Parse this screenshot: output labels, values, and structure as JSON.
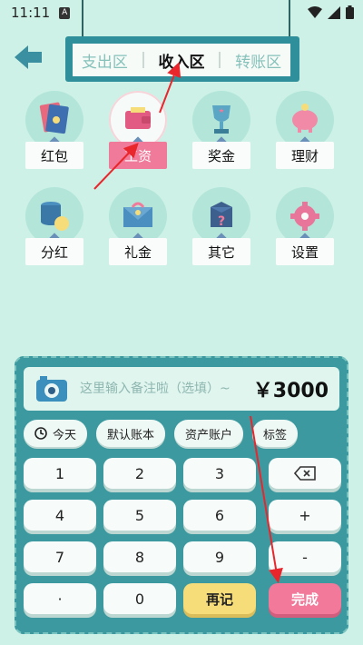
{
  "status": {
    "time": "11:11",
    "notif": "A"
  },
  "header": {
    "tabs": [
      {
        "label": "支出区",
        "active": false
      },
      {
        "label": "收入区",
        "active": true
      },
      {
        "label": "转账区",
        "active": false
      }
    ]
  },
  "categories": [
    {
      "label": "红包",
      "icon": "red-envelope-icon"
    },
    {
      "label": "工资",
      "icon": "wallet-icon",
      "selected": true
    },
    {
      "label": "奖金",
      "icon": "trophy-icon"
    },
    {
      "label": "理财",
      "icon": "piggy-bank-icon"
    },
    {
      "label": "分红",
      "icon": "coins-icon"
    },
    {
      "label": "礼金",
      "icon": "gift-envelope-icon"
    },
    {
      "label": "其它",
      "icon": "question-box-icon"
    },
    {
      "label": "设置",
      "icon": "gear-icon"
    }
  ],
  "entry": {
    "note_placeholder": "这里输入备注啦（选填）~",
    "amount": "￥3000"
  },
  "chips": [
    "今天",
    "默认账本",
    "资产账户",
    "标签"
  ],
  "keypad": {
    "rows": [
      [
        "1",
        "2",
        "3",
        "⌫"
      ],
      [
        "4",
        "5",
        "6",
        "+"
      ],
      [
        "7",
        "8",
        "9",
        "-"
      ],
      [
        "·",
        "0",
        "再记",
        "完成"
      ]
    ]
  },
  "colors": {
    "background": "#cdf1e6",
    "panel": "#3b999f",
    "accent_pink": "#f2799a",
    "accent_yellow": "#f7dd7a"
  }
}
